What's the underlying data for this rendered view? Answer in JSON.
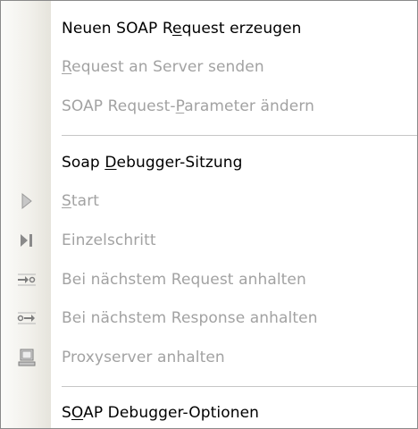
{
  "menu": {
    "items": [
      {
        "label": "Neuen SOAP Request erzeugen",
        "mnemonic": "e",
        "enabled": true
      },
      {
        "label": "Request an Server senden",
        "mnemonic": "R",
        "enabled": false
      },
      {
        "label": "SOAP Request-Parameter ändern",
        "mnemonic": "P",
        "enabled": false
      },
      {
        "label": "Soap Debugger-Sitzung",
        "mnemonic": "D",
        "enabled": true
      },
      {
        "label": "Start",
        "mnemonic": "S",
        "enabled": false,
        "icon": "play-icon"
      },
      {
        "label": "Einzelschritt",
        "enabled": false,
        "icon": "step-icon"
      },
      {
        "label": "Bei nächstem Request anhalten",
        "enabled": false,
        "icon": "break-on-request-icon"
      },
      {
        "label": "Bei nächstem Response anhalten",
        "enabled": false,
        "icon": "break-on-response-icon"
      },
      {
        "label": "Proxyserver anhalten",
        "enabled": false,
        "icon": "proxy-server-icon"
      },
      {
        "label": "SOAP Debugger-Optionen",
        "mnemonic": "O",
        "enabled": true
      }
    ]
  },
  "colors": {
    "enabled_text": "#000000",
    "disabled_text": "#a2a2a2",
    "icon_gray": "#9a9a9a",
    "separator": "#c6c6c6"
  }
}
